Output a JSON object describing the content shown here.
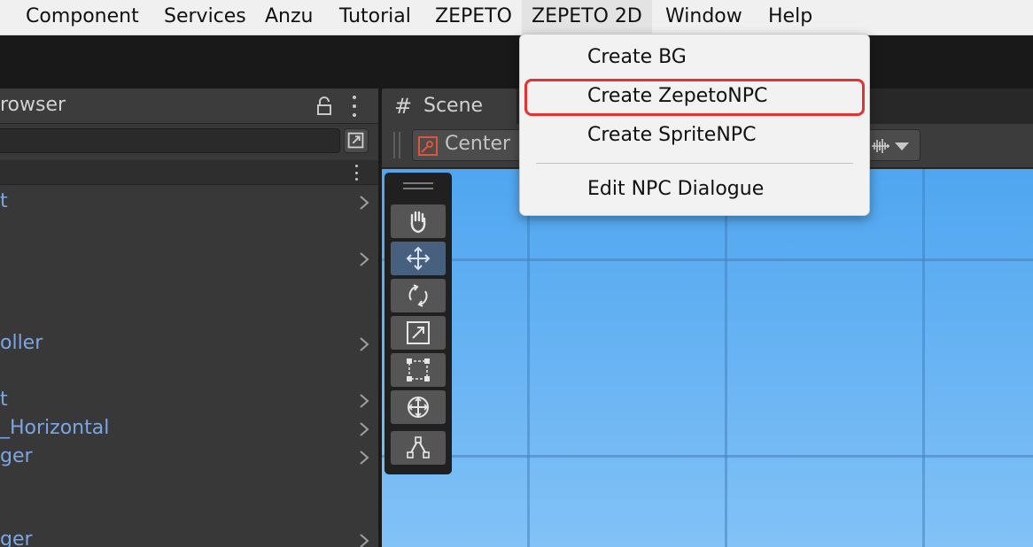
{
  "menubar": {
    "items": [
      "Component",
      "Services",
      "Anzu",
      "Tutorial",
      "ZEPETO",
      "ZEPETO 2D",
      "Window",
      "Help"
    ],
    "open_item": "ZEPETO 2D"
  },
  "left_panel": {
    "title": "rowser",
    "search": {
      "value": "",
      "placeholder": ""
    },
    "items": [
      "t",
      "",
      "oller",
      "t",
      "_Horizontal",
      "ger",
      "ger"
    ]
  },
  "scene": {
    "tab_icon": "#",
    "tab_label": "Scene",
    "pivot_label": "Center",
    "sky_color": "#6db6f4"
  },
  "dropdown": {
    "items": [
      "Create BG",
      "Create ZepetoNPC",
      "Create SpriteNPC",
      "Edit NPC Dialogue"
    ],
    "highlighted": "Create ZepetoNPC",
    "highlight_color": "#e5312f"
  },
  "tools": [
    "hand-tool",
    "move-tool",
    "rotate-tool",
    "scale-tool",
    "rect-tool",
    "transform-tool",
    "custom-tool"
  ]
}
